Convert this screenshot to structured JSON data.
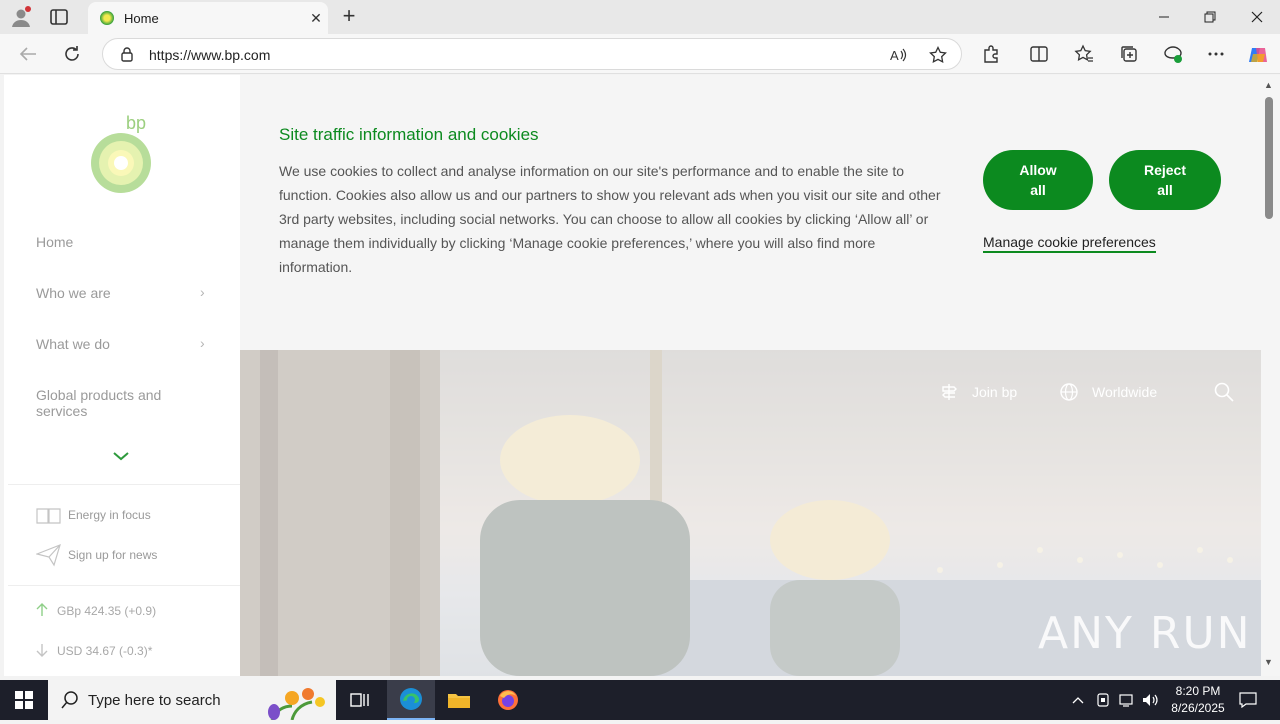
{
  "browser": {
    "tab_title": "Home",
    "url": "https://www.bp.com",
    "new_tab_symbol": "+",
    "close_symbol": "✕"
  },
  "sidebar": {
    "logo_text": "bp",
    "nav": [
      {
        "label": "Home"
      },
      {
        "label": "Who we are"
      },
      {
        "label": "What we do"
      },
      {
        "label": "Global products and services"
      }
    ],
    "links": [
      {
        "label": "Energy in focus"
      },
      {
        "label": "Sign up for news"
      }
    ],
    "stocks": [
      {
        "label": "GBp 424.35 (+0.9)",
        "direction": "up"
      },
      {
        "label": "USD 34.67 (-0.3)*",
        "direction": "down"
      }
    ]
  },
  "cookie_banner": {
    "title": "Site traffic information and cookies",
    "body": "We use cookies to collect and analyse information on our site's performance and to enable the site to function. Cookies also allow us and our partners to show you relevant ads when you visit our site and other 3rd party websites, including social networks. You can choose to allow all cookies by clicking ‘Allow all’ or manage them individually by clicking ‘Manage cookie preferences,’ where you will also find more information.",
    "allow_line1": "Allow",
    "allow_line2": "all",
    "reject_line1": "Reject",
    "reject_line2": "all",
    "manage_label": "Manage cookie preferences"
  },
  "hero": {
    "join_label": "Join bp",
    "worldwide_label": "Worldwide",
    "watermark": "ANY RUN"
  },
  "taskbar": {
    "search_placeholder": "Type here to search",
    "time": "8:20 PM",
    "date": "8/26/2025"
  },
  "colors": {
    "brand_green": "#0c8a1f",
    "taskbar": "#1d1f2a"
  }
}
